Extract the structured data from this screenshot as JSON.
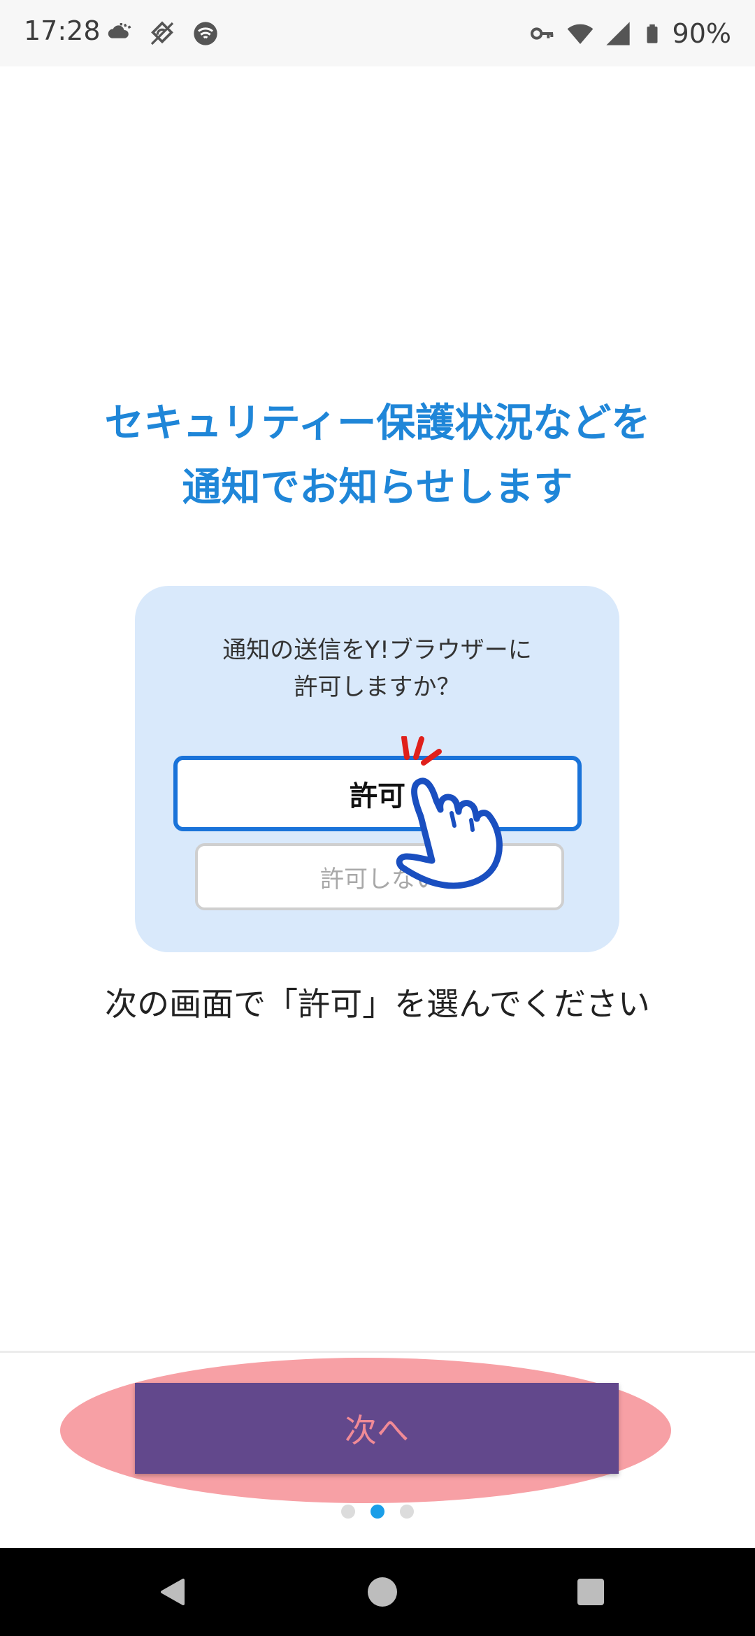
{
  "status_bar": {
    "time": "17:28",
    "battery": "90%",
    "icons_left": [
      "weather-icon",
      "sync-icon",
      "wifi-calling-icon"
    ],
    "icons_right": [
      "vpn-key-icon",
      "wifi-icon",
      "cellular-icon",
      "battery-icon"
    ]
  },
  "onboarding": {
    "headline_line1": "セキュリティー保護状況などを",
    "headline_line2": "通知でお知らせします",
    "illustration": {
      "question_line1": "通知の送信をY!ブラウザーに",
      "question_line2": "許可しますか？",
      "allow_label": "許可",
      "deny_label": "許可しない"
    },
    "instruction": "次の画面で「許可」を選んでください",
    "next_label": "次へ",
    "pager": {
      "total": 3,
      "current": 2
    }
  },
  "colors": {
    "headline": "#1f86d8",
    "card_bg": "#d9e9fb",
    "allow_border": "#1a73d9",
    "next_button": "#62488c",
    "highlight": "#f7a0a5",
    "pager_active": "#1a9ee8"
  },
  "navigation_bar": [
    "back-icon",
    "home-icon",
    "recents-icon"
  ]
}
